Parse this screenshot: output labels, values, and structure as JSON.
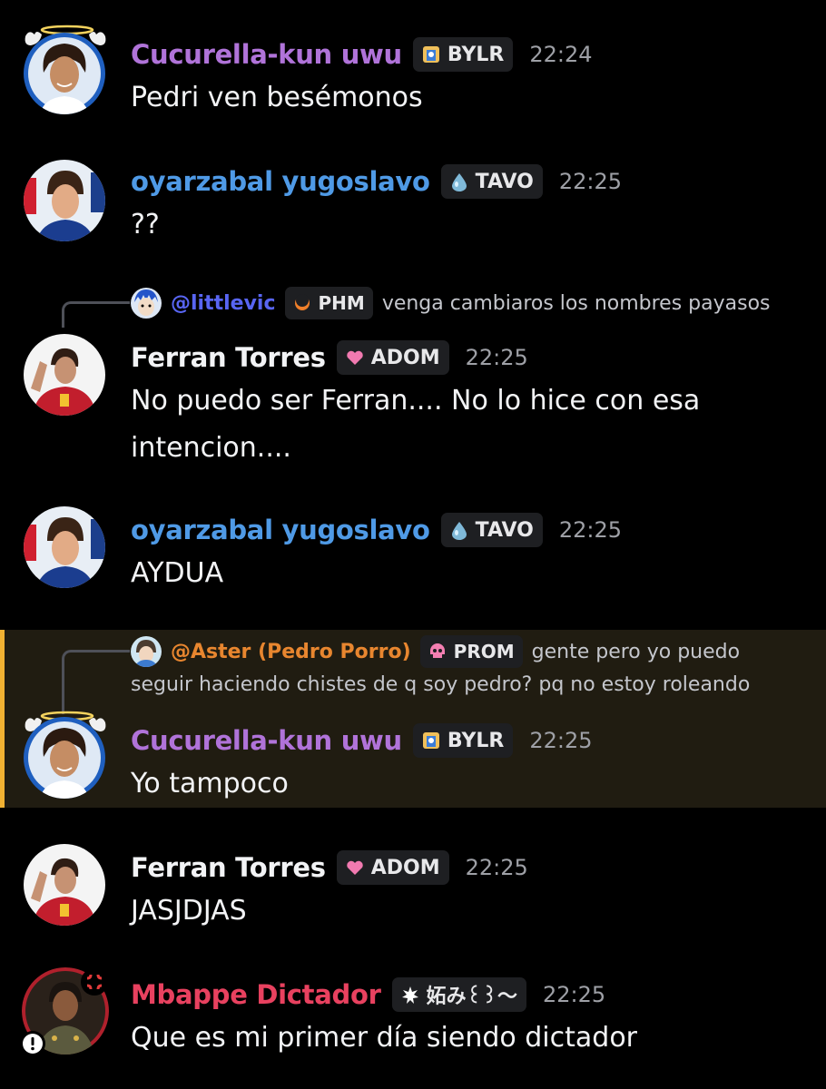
{
  "colors": {
    "cucurella_name": "#b073d9",
    "oyarzabal_name": "#4f9ae6",
    "ferran_name": "#f2f3f5",
    "mbappe_name": "#e8415f",
    "littlevic_reply": "#5865f2",
    "aster_reply": "#e8862f",
    "mention_highlight_bg": "#201c11",
    "mention_highlight_bar": "#f0b132"
  },
  "messages": [
    {
      "username": "Cucurella-kun uwu",
      "tag_icon": "shrine-icon",
      "tag": "BYLR",
      "time": "22:24",
      "text": "Pedri ven besémonos"
    },
    {
      "username": "oyarzabal yugoslavo",
      "tag_icon": "water-drop-icon",
      "tag": "TAVO",
      "time": "22:25",
      "text": "??"
    },
    {
      "reply": {
        "name": "@littlevic",
        "tag_icon": "crescent-icon",
        "tag": "PHM",
        "text": "venga cambiaros los nombres payasos"
      },
      "username": "Ferran Torres",
      "tag_icon": "pink-heart-icon",
      "tag": "ADOM",
      "time": "22:25",
      "text_line1": "No puedo ser Ferran.... No lo hice con esa",
      "text_line2": "intencion...."
    },
    {
      "username": "oyarzabal yugoslavo",
      "tag_icon": "water-drop-icon",
      "tag": "TAVO",
      "time": "22:25",
      "text": "AYDUA"
    },
    {
      "reply": {
        "name": "@Aster (Pedro Porro)",
        "tag_icon": "skull-icon",
        "tag": "PROM",
        "text_line1": "gente pero yo puedo",
        "text_line2": "seguir haciendo chistes de q soy pedro? pq no estoy roleando"
      },
      "username": "Cucurella-kun uwu",
      "tag_icon": "shrine-icon",
      "tag": "BYLR",
      "time": "22:25",
      "text": "Yo tampoco"
    },
    {
      "username": "Ferran Torres",
      "tag_icon": "pink-heart-icon",
      "tag": "ADOM",
      "time": "22:25",
      "text": "JASJDJAS"
    },
    {
      "username": "Mbappe Dictador",
      "tag_icon": "leaf-icon",
      "tag": "妬み꒰꒱〜",
      "time": "22:25",
      "text": "Que es mi primer día siendo dictador"
    }
  ]
}
